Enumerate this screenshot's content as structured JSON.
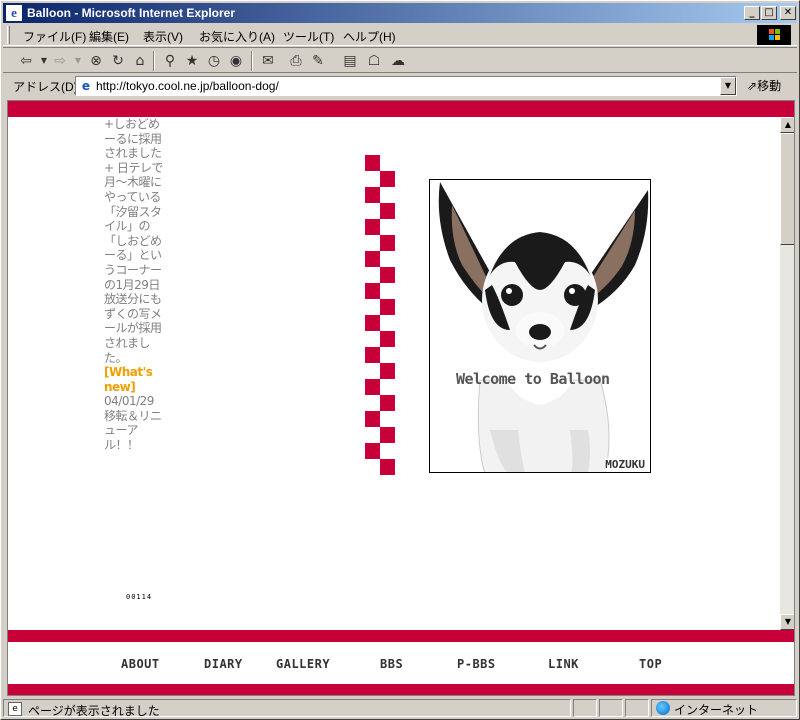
{
  "window": {
    "title": "Balloon - Microsoft Internet Explorer",
    "minimize": "_",
    "maximize": "□",
    "close": "✕"
  },
  "menu": {
    "items": [
      "ファイル(F)",
      "編集(E)",
      "表示(V)",
      "お気に入り(A)",
      "ツール(T)",
      "ヘルプ(H)"
    ]
  },
  "toolbar": {
    "icons": [
      "back-icon",
      "forward-icon",
      "stop-icon",
      "refresh-icon",
      "home-icon",
      "search-icon",
      "favorites-icon",
      "history-icon",
      "media-icon",
      "mail-icon",
      "print-icon",
      "edit-icon",
      "discuss-icon",
      "messenger-icon"
    ]
  },
  "address": {
    "label": "アドレス(D)",
    "url": "http://tokyo.cool.ne.jp/balloon-dog/",
    "go_label": "移動"
  },
  "page": {
    "news_text": "+しおどめーるに採用されました+ 日テレで月～木曜にやっている「汐留スタイル」の「しおどめーる」というコーナーの1月29日放送分にもずくの写メールが採用されました。",
    "whats_new": "[What's new]",
    "update_date": "04/01/29",
    "update_text": "移転＆リニューアル！！",
    "counter": "00114",
    "photo_welcome": "Welcome to Balloon",
    "photo_name": "MOZUKU"
  },
  "nav": {
    "items": [
      "ABOUT",
      "DIARY",
      "GALLERY",
      "BBS",
      "P-BBS",
      "LINK",
      "TOP"
    ]
  },
  "status": {
    "text": "ページが表示されました",
    "zone": "インターネット"
  },
  "colors": {
    "accent": "#c8003a",
    "whats_new": "#f0a000",
    "title_gradient_start": "#0a246a",
    "title_gradient_end": "#a6caf0"
  }
}
